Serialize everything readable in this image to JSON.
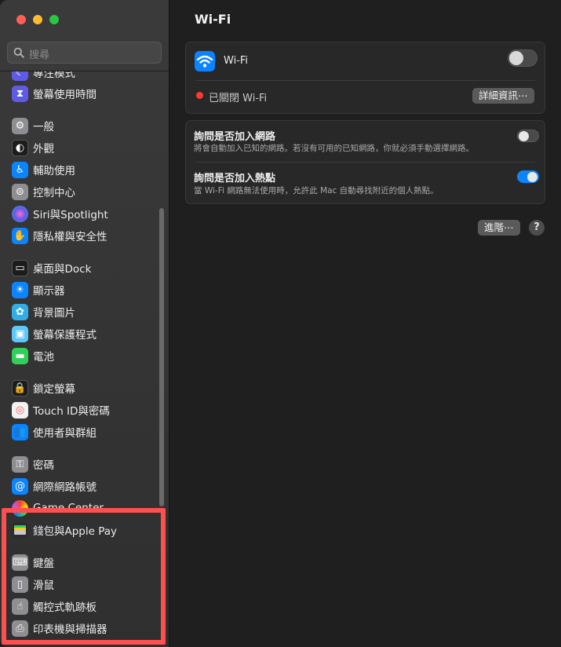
{
  "search": {
    "placeholder": "搜尋"
  },
  "sidebar": {
    "items": [
      {
        "label": "專注模式",
        "icon": "focus-moon-icon",
        "color": "#5e5ce6"
      },
      {
        "label": "螢幕使用時間",
        "icon": "hourglass-icon",
        "color": "#5e5ce6"
      },
      {
        "label": "一般",
        "icon": "gear-icon",
        "color": "#8e8e93"
      },
      {
        "label": "外觀",
        "icon": "appearance-icon",
        "color": "#1c1c1e"
      },
      {
        "label": "輔助使用",
        "icon": "accessibility-icon",
        "color": "#0a84ff"
      },
      {
        "label": "控制中心",
        "icon": "control-center-icon",
        "color": "#8e8e93"
      },
      {
        "label": "Siri與Spotlight",
        "icon": "siri-icon",
        "color": "#bf5af2"
      },
      {
        "label": "隱私權與安全性",
        "icon": "hand-icon",
        "color": "#0a84ff"
      },
      {
        "label": "桌面與Dock",
        "icon": "dock-icon",
        "color": "#1c1c1e"
      },
      {
        "label": "顯示器",
        "icon": "display-sun-icon",
        "color": "#0a84ff"
      },
      {
        "label": "背景圖片",
        "icon": "wallpaper-flower-icon",
        "color": "#32ade6"
      },
      {
        "label": "螢幕保護程式",
        "icon": "screensaver-icon",
        "color": "#5ac8fa"
      },
      {
        "label": "電池",
        "icon": "battery-icon",
        "color": "#30d158"
      },
      {
        "label": "鎖定螢幕",
        "icon": "lock-icon",
        "color": "#1c1c1e"
      },
      {
        "label": "Touch ID與密碼",
        "icon": "fingerprint-icon",
        "color": "#ff6b6b"
      },
      {
        "label": "使用者與群組",
        "icon": "users-icon",
        "color": "#0a84ff"
      },
      {
        "label": "密碼",
        "icon": "key-icon",
        "color": "#8e8e93"
      },
      {
        "label": "網際網路帳號",
        "icon": "at-icon",
        "color": "#0a84ff"
      },
      {
        "label": "Game Center",
        "icon": "game-center-icon",
        "color": "#ffffff"
      },
      {
        "label": "錢包與Apple Pay",
        "icon": "wallet-icon",
        "color": "#1c1c1e"
      },
      {
        "label": "鍵盤",
        "icon": "keyboard-icon",
        "color": "#8e8e93"
      },
      {
        "label": "滑鼠",
        "icon": "mouse-icon",
        "color": "#8e8e93"
      },
      {
        "label": "觸控式軌跡板",
        "icon": "trackpad-icon",
        "color": "#8e8e93"
      },
      {
        "label": "印表機與掃描器",
        "icon": "printer-icon",
        "color": "#8e8e93"
      }
    ]
  },
  "main": {
    "title": "Wi-Fi",
    "wifi": {
      "label": "Wi-Fi",
      "enabled": false,
      "status_text": "已關閉 Wi-Fi",
      "details_button": "詳細資訊⋯"
    },
    "ask_join_networks": {
      "label": "詢問是否加入網路",
      "description": "將會自動加入已知的網路。若沒有可用的已知網路，你就必須手動選擇網路。",
      "enabled": false
    },
    "ask_join_hotspots": {
      "label": "詢問是否加入熱點",
      "description": "當 Wi-Fi 網路無法使用時，允許此 Mac 自動尋找附近的個人熱點。",
      "enabled": true
    },
    "advanced_button": "進階⋯",
    "help_button": "?"
  }
}
